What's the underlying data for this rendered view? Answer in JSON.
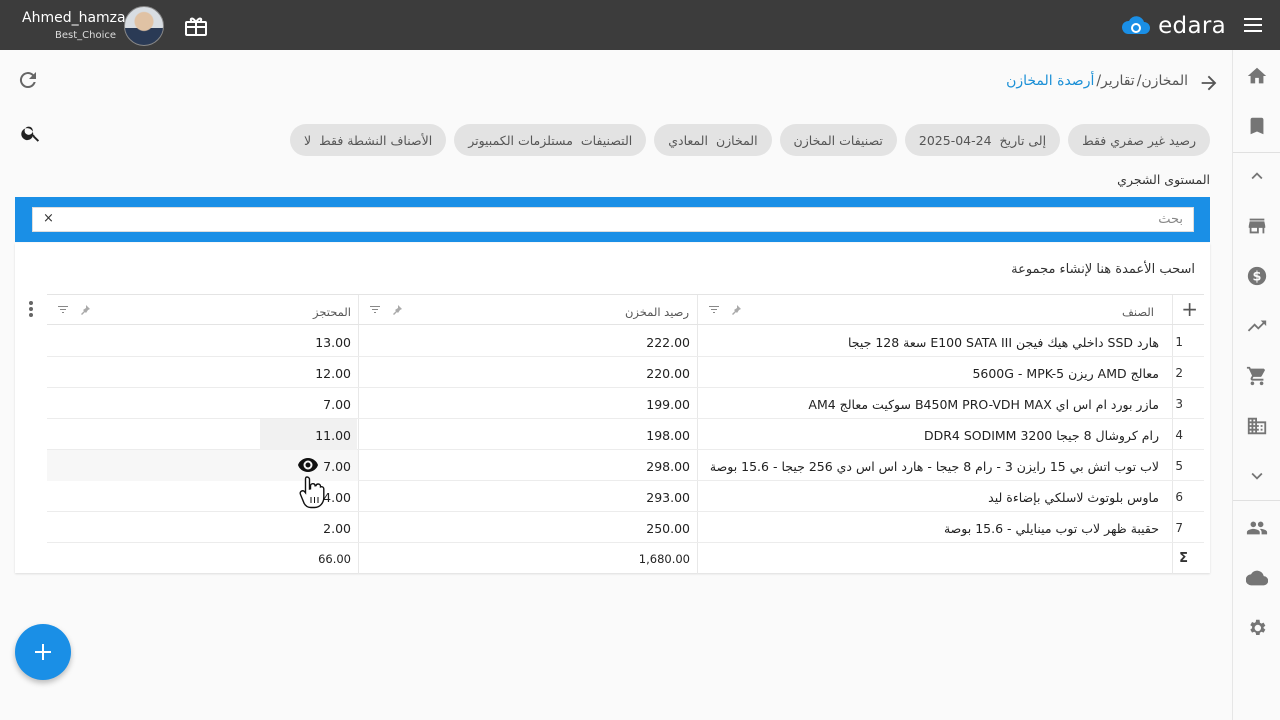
{
  "topbar": {
    "user_name": "Ahmed_hamza",
    "company": "Best_Choice",
    "logo_text": "edara",
    "accent": "#1a8fe6",
    "bg": "#3c3c3c"
  },
  "breadcrumb": {
    "items": [
      "المخازن/",
      "تقارير/",
      "أرصدة المخازن"
    ]
  },
  "filters": [
    {
      "text": "رصيد غير صفري فقط"
    },
    {
      "label": "إلى تاريخ",
      "value": "2025-04-24"
    },
    {
      "text": "تصنيفات المخازن"
    },
    {
      "label": "المخازن",
      "value": "المعادي"
    },
    {
      "label": "التصنيفات",
      "value": "مستلزمات الكمبيوتر"
    },
    {
      "label": "الأصناف النشطة فقط",
      "value": "لا"
    }
  ],
  "tree_level_label": "المستوى الشجري",
  "search": {
    "placeholder": "بحث",
    "clear": "×"
  },
  "grid": {
    "group_hint": "اسحب الأعمدة هنا لإنشاء مجموعة",
    "columns": {
      "item": "الصنف",
      "balance": "رصيد المخزن",
      "reserved": "المحتجز"
    },
    "rows": [
      {
        "idx": "1",
        "name": "هارد SSD داخلي هيك فيجن E100 SATA III سعة 128 جيجا",
        "balance": "222.00",
        "reserved": "13.00"
      },
      {
        "idx": "2",
        "name": "معالج AMD ريزن 5600G - MPK-5",
        "balance": "220.00",
        "reserved": "12.00"
      },
      {
        "idx": "3",
        "name": "مازر بورد ام اس اي B450M PRO-VDH MAX سوكيت معالج AM4",
        "balance": "199.00",
        "reserved": "7.00"
      },
      {
        "idx": "4",
        "name": "رام كروشال 8 جيجا DDR4 SODIMM 3200",
        "balance": "198.00",
        "reserved": "11.00"
      },
      {
        "idx": "5",
        "name": "لاب توب اتش بي 15 رايزن 3 - رام 8 جيجا - هارد اس اس دي 256 جيجا - 15.6 بوصة",
        "balance": "298.00",
        "reserved": "7.00"
      },
      {
        "idx": "6",
        "name": "ماوس بلوتوث لاسلكي بإضاءة ليد",
        "balance": "293.00",
        "reserved": "4.00"
      },
      {
        "idx": "7",
        "name": "حقيبة ظهر لاب توب مينايلي - 15.6 بوصة",
        "balance": "250.00",
        "reserved": "2.00"
      }
    ],
    "footer": {
      "sigma": "Σ",
      "balance": "1,680.00",
      "reserved": "66.00"
    }
  },
  "icons": {
    "sidebar": [
      "home-icon",
      "bookmark-icon",
      "chevron-up-icon",
      "store-icon",
      "dollar-icon",
      "trending-up-icon",
      "cart-icon",
      "building-icon",
      "chevron-down-icon",
      "people-icon",
      "cloud-icon",
      "settings-icon"
    ]
  }
}
